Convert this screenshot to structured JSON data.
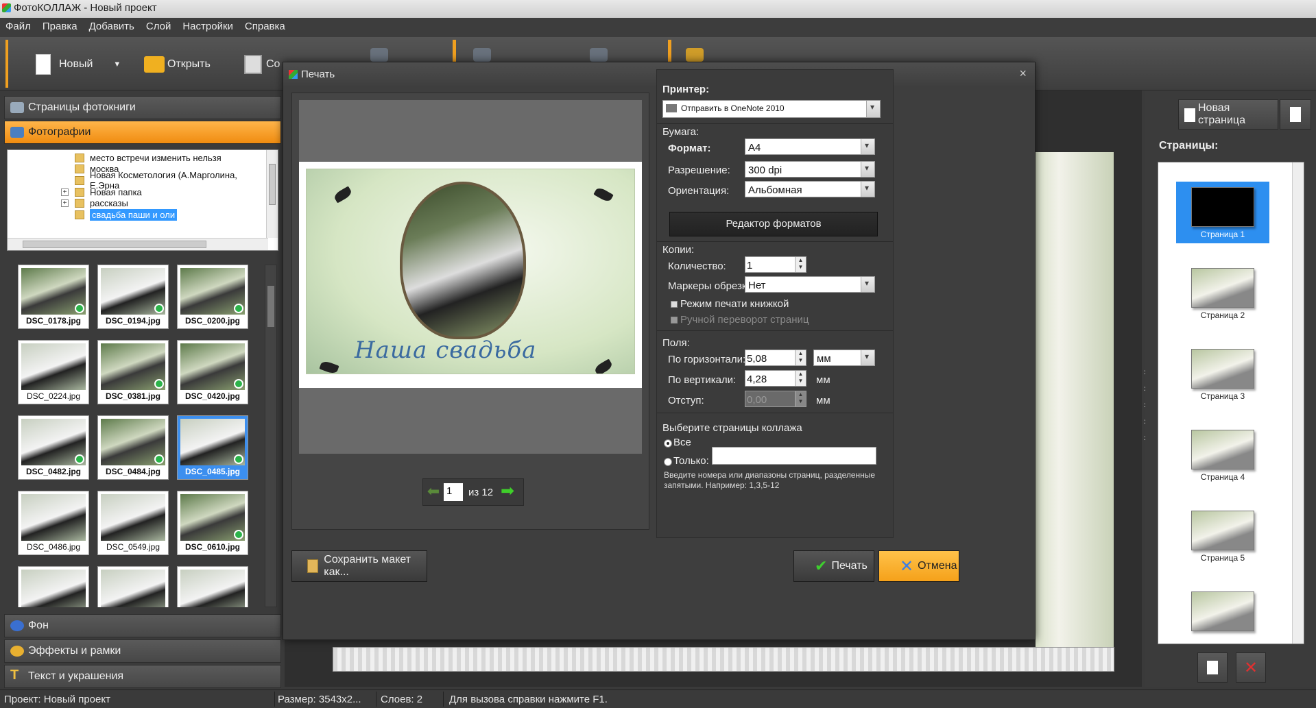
{
  "window": {
    "title": "ФотоКОЛЛАЖ - Новый проект"
  },
  "menu": [
    "Файл",
    "Правка",
    "Добавить",
    "Слой",
    "Настройки",
    "Справка"
  ],
  "toolbar": {
    "new_label": "Новый",
    "open_label": "Открыть",
    "save_label": "Со"
  },
  "left": {
    "sections": {
      "pages": "Страницы фотокниги",
      "photos": "Фотографии",
      "background": "Фон",
      "effects": "Эффекты и рамки",
      "text": "Текст и украшения"
    },
    "folders": [
      "место встречи изменить нельзя",
      "москва",
      "Новая Косметология (А.Марголина, Е.Эрна",
      "Новая папка",
      "рассказы",
      "свадьба паши и оли"
    ],
    "thumbs": [
      "DSC_0178.jpg",
      "DSC_0194.jpg",
      "DSC_0200.jpg",
      "DSC_0224.jpg",
      "DSC_0381.jpg",
      "DSC_0420.jpg",
      "DSC_0482.jpg",
      "DSC_0484.jpg",
      "DSC_0485.jpg",
      "DSC_0486.jpg",
      "DSC_0549.jpg",
      "DSC_0610.jpg"
    ]
  },
  "right": {
    "new_page_label": "Новая страница",
    "pages_title": "Страницы:",
    "pages": [
      "Страница 1",
      "Страница 2",
      "Страница 3",
      "Страница 4",
      "Страница 5"
    ]
  },
  "status": {
    "project": "Проект: Новый проект",
    "size": "Размер: 3543x2...",
    "layers": "Слоев: 2",
    "hint": "Для вызова справки нажмите F1."
  },
  "dialog": {
    "title": "Печать",
    "preview_title": "Наша свадьба",
    "pager": {
      "current": "1",
      "of": "из 12"
    },
    "printer_label": "Принтер:",
    "printer_value": "Отправить в OneNote 2010",
    "paper_label": "Бумага:",
    "format_label": "Формат:",
    "format_value": "A4",
    "resolution_label": "Разрешение:",
    "resolution_value": "300 dpi",
    "orientation_label": "Ориентация:",
    "orientation_value": "Альбомная",
    "format_editor": "Редактор форматов",
    "copies_label": "Копии:",
    "quantity_label": "Количество:",
    "quantity_value": "1",
    "crop_label": "Маркеры обрезки",
    "crop_value": "Нет",
    "book_mode": "Режим печати книжкой",
    "manual_flip": "Ручной переворот страниц",
    "margins_label": "Поля:",
    "horiz_label": "По горизонтали:",
    "horiz_value": "5,08",
    "vert_label": "По вертикали:",
    "vert_value": "4,28",
    "offset_label": "Отступ:",
    "offset_value": "0,00",
    "unit": "мм",
    "pages_select": "Выберите страницы коллажа",
    "all": "Все",
    "only": "Только:",
    "hint": "Введите номера или диапазоны страниц, разделенные запятыми. Например: 1,3,5-12",
    "save_layout": "Сохранить макет как...",
    "print": "Печать",
    "cancel": "Отмена"
  }
}
